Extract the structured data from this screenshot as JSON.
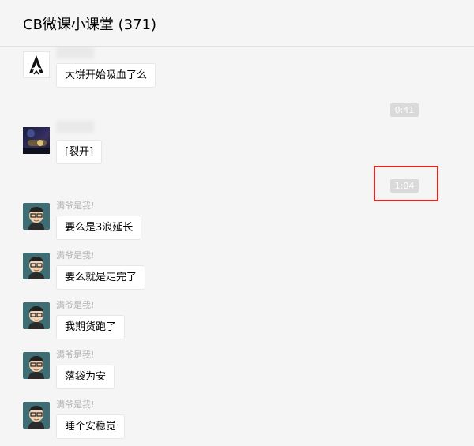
{
  "header": {
    "title": "CB微课小课堂 (371)"
  },
  "messages": [
    {
      "text": "大饼开始吸血了么",
      "nickname": ""
    },
    {
      "text": "[裂开]",
      "nickname": ""
    },
    {
      "text": "要么是3浪延长",
      "nickname": "满爷是我!"
    },
    {
      "text": "要么就是走完了",
      "nickname": "满爷是我!"
    },
    {
      "text": "我期货跑了",
      "nickname": "满爷是我!"
    },
    {
      "text": "落袋为安",
      "nickname": "满爷是我!"
    },
    {
      "text": "睡个安稳觉",
      "nickname": "满爷是我!"
    }
  ],
  "timestamps": [
    "0:41",
    "1:04"
  ],
  "colors": {
    "highlight_box": "#e0261e",
    "time_badge": "#dadada",
    "avatar_bg": "#3e6e74"
  },
  "icons": [
    "assassin-logo-avatar",
    "photo-avatar",
    "cartoon-glasses-avatar"
  ]
}
